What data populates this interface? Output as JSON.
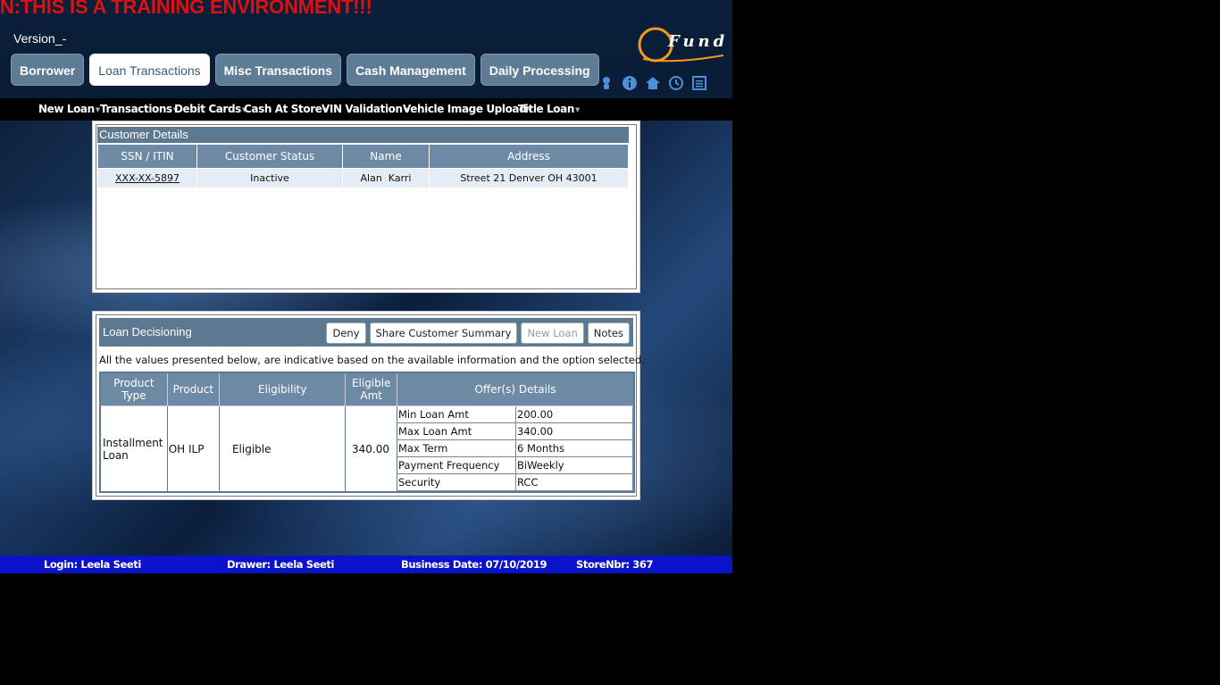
{
  "banner": "N:THIS IS A TRAINING ENVIRONMENT!!!",
  "version": "Version_-",
  "logo_text": "Fund",
  "tabs": [
    {
      "label": "Borrower"
    },
    {
      "label": "Loan Transactions",
      "active": true
    },
    {
      "label": "Misc Transactions"
    },
    {
      "label": "Cash Management"
    },
    {
      "label": "Daily Processing"
    }
  ],
  "top_icons": [
    "user-icon",
    "info-icon",
    "home-icon",
    "clock-icon",
    "list-icon"
  ],
  "subnav": [
    {
      "label": "New Loan"
    },
    {
      "label": "Transactions"
    },
    {
      "label": "Debit Cards"
    },
    {
      "label": "Cash At Store"
    },
    {
      "label": "VIN Validation"
    },
    {
      "label": "Vehicle Image Upload"
    },
    {
      "label": "Title Loan"
    }
  ],
  "customer": {
    "title": "Customer Details",
    "headers": [
      "SSN / ITIN",
      "Customer Status",
      "Name",
      "Address"
    ],
    "row": {
      "ssn": "XXX-XX-5897",
      "status": "Inactive",
      "name": "Alan  Karri",
      "address": "Street 21 Denver OH 43001"
    }
  },
  "loan": {
    "title": "Loan Decisioning",
    "buttons": {
      "deny": "Deny",
      "share": "Share Customer Summary",
      "new_loan": "New Loan",
      "notes": "Notes"
    },
    "note": "All the values presented below, are indicative based on the available information and the option selected.",
    "headers": {
      "product_type": "Product Type",
      "product": "Product",
      "eligibility": "Eligibility",
      "eligible_amt": "Eligible Amt",
      "offers": "Offer(s) Details"
    },
    "row": {
      "product_type": "Installment Loan",
      "product": "OH ILP",
      "eligibility": "Eligible",
      "eligible_amt": "340.00"
    },
    "offers": [
      {
        "label": "Min Loan Amt",
        "value": "200.00"
      },
      {
        "label": "Max Loan Amt",
        "value": "340.00"
      },
      {
        "label": "Max Term",
        "value": "6 Months"
      },
      {
        "label": "Payment Frequency",
        "value": "BiWeekly"
      },
      {
        "label": "Security",
        "value": "RCC"
      }
    ]
  },
  "footer": {
    "login": "Login: Leela Seeti",
    "drawer": "Drawer: Leela Seeti",
    "business_date": "Business Date: 07/10/2019",
    "store": "StoreNbr: 367"
  },
  "colors": {
    "banner": "#e01010",
    "header_blue": "#5d7891",
    "footer_blue": "#0a13c8"
  }
}
